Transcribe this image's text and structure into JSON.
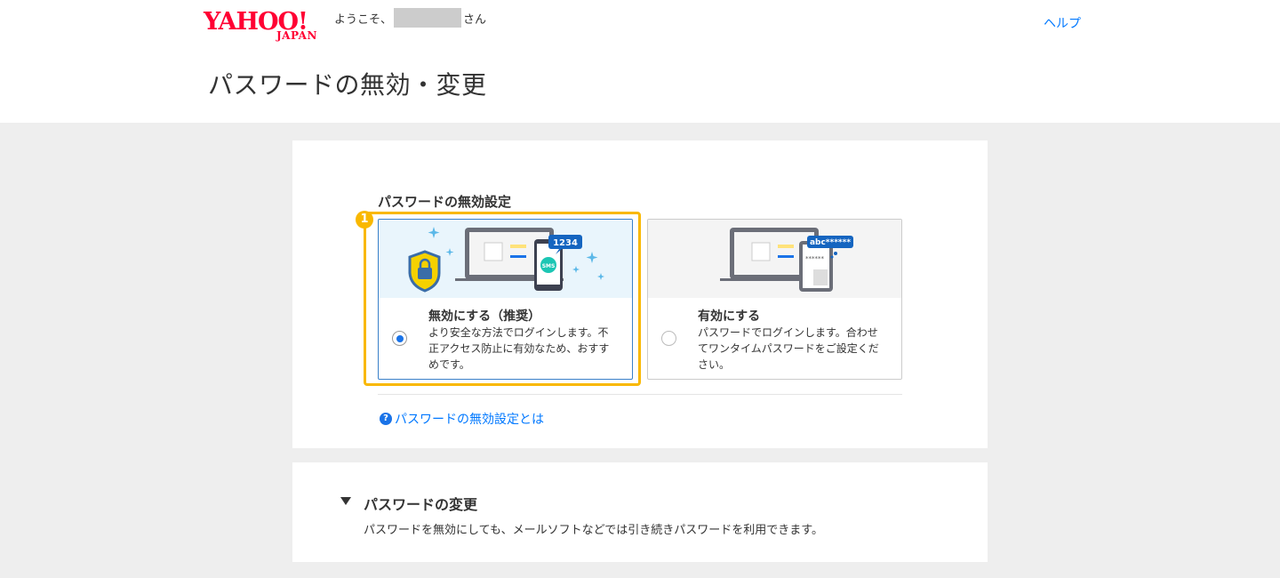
{
  "header": {
    "logo_main": "YAHOO!",
    "logo_sub": "JAPAN",
    "welcome_prefix": "ようこそ、",
    "welcome_suffix": "さん",
    "help_label": "ヘルプ"
  },
  "page_title": "パスワードの無効・変更",
  "disable_setting": {
    "section_label": "パスワードの無効設定",
    "badge_number": "1",
    "options": [
      {
        "title": "無効にする（推奨）",
        "description": "より安全な方法でログインします。不正アクセス防止に有効なため、おすすめです。",
        "bubble_text": "1234",
        "sms_text": "SMS",
        "selected": true
      },
      {
        "title": "有効にする",
        "description": "パスワードでログインします。合わせてワンタイムパスワードをご設定ください。",
        "bubble_text": "abc******",
        "selected": false
      }
    ],
    "about_link": "パスワードの無効設定とは",
    "about_icon": "?"
  },
  "password_change": {
    "title": "パスワードの変更",
    "description": "パスワードを無効にしても、メールソフトなどでは引き続きパスワードを利用できます。"
  },
  "colors": {
    "accent_blue": "#0078ff",
    "brand_red": "#ff0033",
    "highlight_yellow": "#f9b800"
  }
}
